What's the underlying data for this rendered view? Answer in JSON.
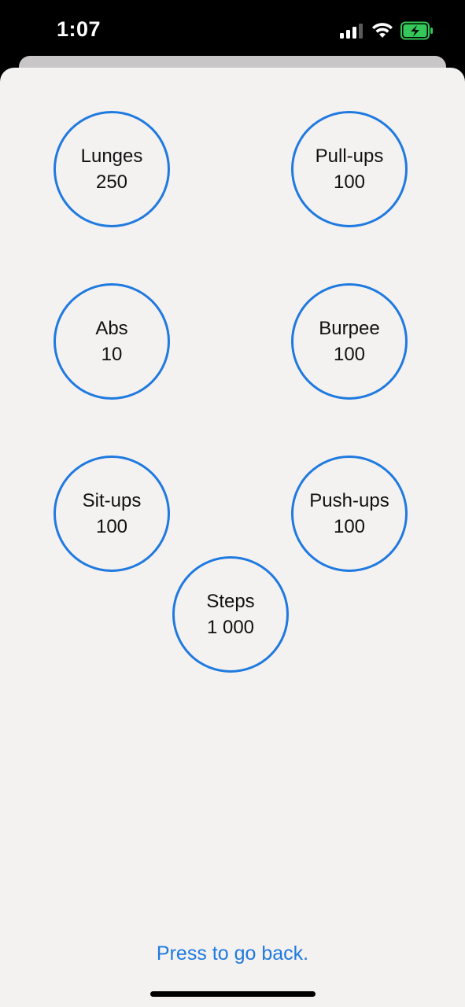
{
  "status_bar": {
    "time": "1:07",
    "icons": [
      "signal-icon",
      "wifi-icon",
      "battery-charging-icon"
    ],
    "battery_color": "#34c759"
  },
  "colors": {
    "accent": "#1f7ae0",
    "sheet_background": "#f4f1f1"
  },
  "exercises": [
    {
      "name": "Lunges",
      "count": "250"
    },
    {
      "name": "Pull-ups",
      "count": "100"
    },
    {
      "name": "Abs",
      "count": "10"
    },
    {
      "name": "Burpee",
      "count": "100"
    },
    {
      "name": "Sit-ups",
      "count": "100"
    },
    {
      "name": "Push-ups",
      "count": "100"
    },
    {
      "name": "Steps",
      "count": "1 000"
    }
  ],
  "back_link": "Press to go back."
}
